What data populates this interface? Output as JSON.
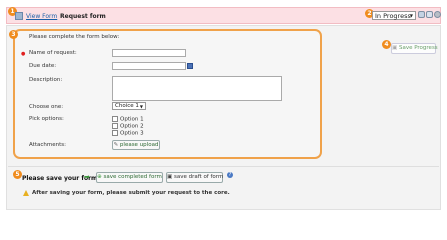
{
  "header": {
    "view_form_link": "View Form",
    "title": "Request form",
    "status": "In Progress",
    "status_arrow": "▼"
  },
  "badges": [
    "1",
    "2",
    "3",
    "4",
    "5"
  ],
  "form": {
    "intro": "Please complete the form below:",
    "fields": {
      "name": {
        "label": "Name of request:",
        "value": "",
        "required": true
      },
      "due_date": {
        "label": "Due date:",
        "value": ""
      },
      "description": {
        "label": "Description:",
        "value": ""
      },
      "choose_one": {
        "label": "Choose one:",
        "selected": "Choice 1",
        "arrow": "▼"
      },
      "pick_options": {
        "label": "Pick options:",
        "options": [
          "Option 1",
          "Option 2",
          "Option 3"
        ]
      },
      "attachments": {
        "label": "Attachments:",
        "button": "please upload"
      }
    }
  },
  "save_progress": "Save Progress",
  "footer": {
    "prompt": "Please save your form!",
    "arrow": "➡",
    "save_completed": "save completed form",
    "save_draft": "save draft of form",
    "help": "?",
    "notice": "After saving your form, please submit your request to the core."
  },
  "icons": [
    "form-icon",
    "calendar-icon",
    "help-icon",
    "warning-icon",
    "upload-icon",
    "save-icon"
  ],
  "colors": {
    "accent": "#f08c1e",
    "header_bg": "#fce0e4",
    "link": "#1b5fa8",
    "button_text": "#2d6a33"
  }
}
